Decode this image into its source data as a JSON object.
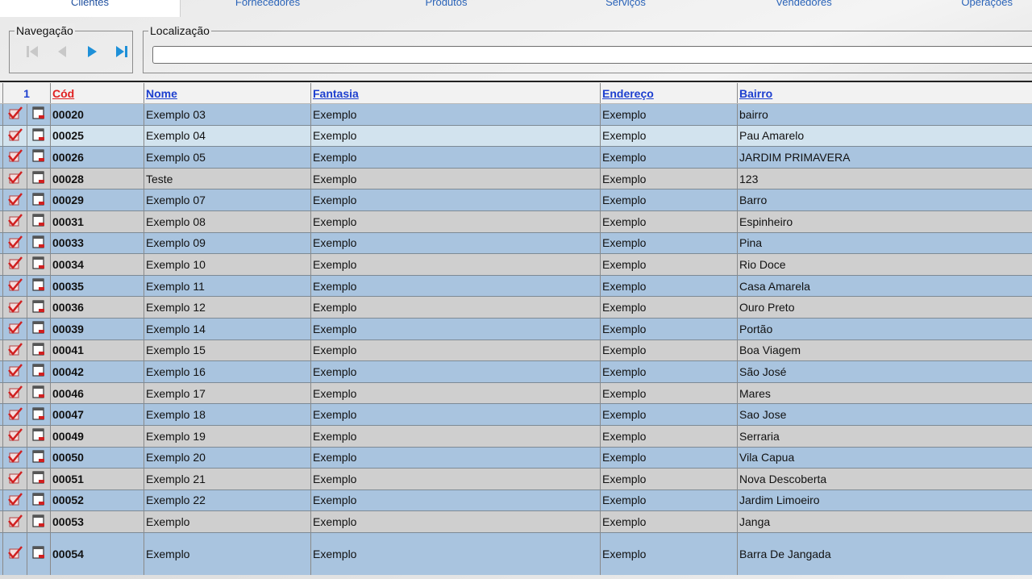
{
  "tabs": [
    {
      "label": "Clientes",
      "active": true
    },
    {
      "label": "Fornecedores",
      "active": false
    },
    {
      "label": "Produtos",
      "active": false
    },
    {
      "label": "Serviços",
      "active": false
    },
    {
      "label": "Vendedores",
      "active": false
    },
    {
      "label": "Operações",
      "active": false
    }
  ],
  "navigation": {
    "legend": "Navegação",
    "buttons": [
      "first-icon",
      "previous-icon",
      "next-icon",
      "last-icon"
    ],
    "active_color": "#1e90d8",
    "disabled_color": "#c8c8c8"
  },
  "location": {
    "legend": "Localização",
    "value": ""
  },
  "grid": {
    "page_number": "1",
    "headers": {
      "cod": "Cód",
      "nome": "Nome",
      "fantasia": "Fantasia",
      "endereco": "Endereço",
      "bairro": "Bairro"
    },
    "rows": [
      {
        "cod": "00020",
        "nome": "Exemplo 03",
        "fantasia": "Exemplo",
        "endereco": "Exemplo",
        "bairro": "bairro",
        "style": "blue"
      },
      {
        "cod": "00025",
        "nome": "Exemplo 04",
        "fantasia": "Exemplo",
        "endereco": "Exemplo",
        "bairro": "Pau Amarelo",
        "style": "light"
      },
      {
        "cod": "00026",
        "nome": "Exemplo 05",
        "fantasia": "Exemplo",
        "endereco": "Exemplo",
        "bairro": "JARDIM PRIMAVERA",
        "style": "blue"
      },
      {
        "cod": "00028",
        "nome": "Teste",
        "fantasia": "Exemplo",
        "endereco": "Exemplo",
        "bairro": "123",
        "style": "gray"
      },
      {
        "cod": "00029",
        "nome": "Exemplo 07",
        "fantasia": "Exemplo",
        "endereco": "Exemplo",
        "bairro": "Barro",
        "style": "blue"
      },
      {
        "cod": "00031",
        "nome": "Exemplo 08",
        "fantasia": "Exemplo",
        "endereco": "Exemplo",
        "bairro": "Espinheiro",
        "style": "gray"
      },
      {
        "cod": "00033",
        "nome": "Exemplo 09",
        "fantasia": "Exemplo",
        "endereco": "Exemplo",
        "bairro": "Pina",
        "style": "blue"
      },
      {
        "cod": "00034",
        "nome": "Exemplo 10",
        "fantasia": "Exemplo",
        "endereco": "Exemplo",
        "bairro": "Rio Doce",
        "style": "gray"
      },
      {
        "cod": "00035",
        "nome": "Exemplo 11",
        "fantasia": "Exemplo",
        "endereco": "Exemplo",
        "bairro": "Casa Amarela",
        "style": "blue"
      },
      {
        "cod": "00036",
        "nome": "Exemplo 12",
        "fantasia": "Exemplo",
        "endereco": "Exemplo",
        "bairro": "Ouro Preto",
        "style": "gray"
      },
      {
        "cod": "00039",
        "nome": "Exemplo 14",
        "fantasia": "Exemplo",
        "endereco": "Exemplo",
        "bairro": "Portão",
        "style": "blue"
      },
      {
        "cod": "00041",
        "nome": "Exemplo 15",
        "fantasia": "Exemplo",
        "endereco": "Exemplo",
        "bairro": "Boa Viagem",
        "style": "gray"
      },
      {
        "cod": "00042",
        "nome": "Exemplo 16",
        "fantasia": "Exemplo",
        "endereco": "Exemplo",
        "bairro": "São José",
        "style": "blue"
      },
      {
        "cod": "00046",
        "nome": "Exemplo 17",
        "fantasia": "Exemplo",
        "endereco": "Exemplo",
        "bairro": "Mares",
        "style": "gray"
      },
      {
        "cod": "00047",
        "nome": "Exemplo 18",
        "fantasia": "Exemplo",
        "endereco": "Exemplo",
        "bairro": "Sao Jose",
        "style": "blue"
      },
      {
        "cod": "00049",
        "nome": "Exemplo 19",
        "fantasia": "Exemplo",
        "endereco": "Exemplo",
        "bairro": "Serraria",
        "style": "gray"
      },
      {
        "cod": "00050",
        "nome": "Exemplo 20",
        "fantasia": "Exemplo",
        "endereco": "Exemplo",
        "bairro": "Vila Capua",
        "style": "blue"
      },
      {
        "cod": "00051",
        "nome": "Exemplo 21",
        "fantasia": "Exemplo",
        "endereco": "Exemplo",
        "bairro": "Nova Descoberta",
        "style": "gray"
      },
      {
        "cod": "00052",
        "nome": "Exemplo 22",
        "fantasia": "Exemplo",
        "endereco": "Exemplo",
        "bairro": "Jardim Limoeiro",
        "style": "blue"
      },
      {
        "cod": "00053",
        "nome": "Exemplo",
        "fantasia": "Exemplo",
        "endereco": "Exemplo",
        "bairro": "Janga",
        "style": "gray"
      },
      {
        "cod": "00054",
        "nome": "Exemplo",
        "fantasia": "Exemplo",
        "endereco": "Exemplo",
        "bairro": "Barra De Jangada",
        "style": "blue tall"
      }
    ],
    "row_icons": {
      "edit": "edit-check-icon",
      "view": "view-record-icon"
    }
  }
}
